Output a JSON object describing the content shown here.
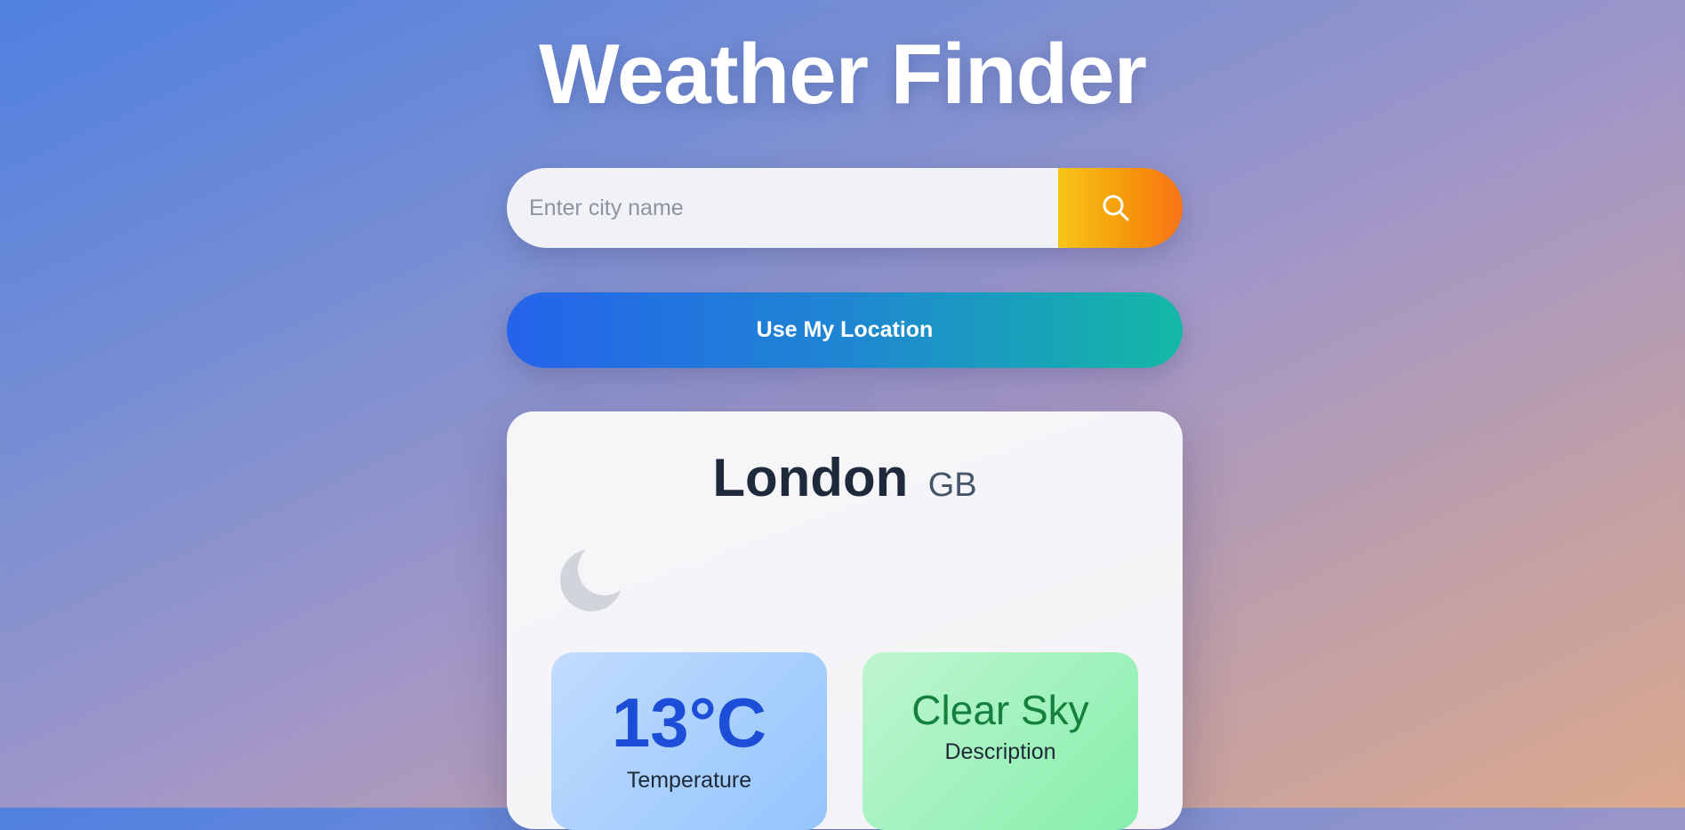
{
  "app": {
    "title": "Weather Finder"
  },
  "search": {
    "placeholder": "Enter city name",
    "value": "",
    "button_icon": "search-icon"
  },
  "location_button": {
    "label": "Use My Location"
  },
  "weather": {
    "city": "London",
    "country": "GB",
    "icon": "moon-icon",
    "temperature": {
      "value": "13°C",
      "label": "Temperature"
    },
    "description": {
      "value": "Clear Sky",
      "label": "Description"
    }
  },
  "colors": {
    "search_button": "#f59e0b",
    "location_button_start": "#2563eb",
    "location_button_end": "#14b8a6",
    "temperature_text": "#1d4ed8",
    "description_text": "#15803d"
  }
}
